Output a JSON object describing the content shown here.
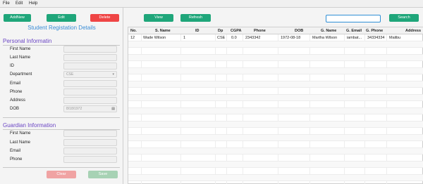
{
  "menu": [
    "File",
    "Edit",
    "Help"
  ],
  "buttons": {
    "add_new": "AddNew",
    "edit": "Edit",
    "delete": "Delete",
    "view": "View",
    "refresh": "Refresh",
    "search": "Search",
    "clear": "Clear",
    "save": "Save"
  },
  "form": {
    "title": "Student Registation Details",
    "personal_section": "Personal Informatin",
    "personal_fields": [
      "First Name",
      "Last Name",
      "ID",
      "Department",
      "Email",
      "Phone",
      "Address",
      "DOB"
    ],
    "department_value": "CSE",
    "dob_value": "8/18/1972",
    "guardian_section": "Guardian Information",
    "guardian_fields": [
      "First Name",
      "Last Name",
      "Email",
      "Phone"
    ]
  },
  "search": {
    "value": ""
  },
  "table": {
    "columns": [
      "No.",
      "S. Name",
      "ID",
      "Dp",
      "CGPA",
      "Phone",
      "DOB",
      "G. Name",
      "G. Email",
      "G. Phone",
      "Address"
    ],
    "rows": [
      [
        "12",
        "Wade Wilson",
        "1",
        "CSE",
        "0.0",
        "2343342",
        "1972-08-18",
        "Martha Wilson",
        "iambat...",
        "34334334",
        "Malibu"
      ]
    ]
  },
  "colors": {
    "accent_green": "#1fa67a",
    "accent_red": "#ef4545",
    "title_blue": "#3a8dd6",
    "section_purple": "#6a45c4"
  }
}
